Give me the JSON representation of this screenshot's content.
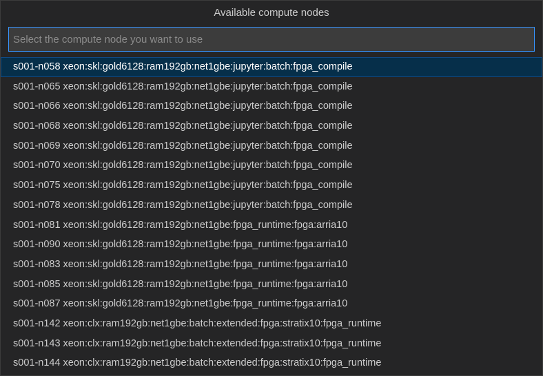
{
  "dialog": {
    "title": "Available compute nodes",
    "input_placeholder": "Select the compute node you want to use",
    "input_value": ""
  },
  "items": [
    {
      "label": "s001-n058 xeon:skl:gold6128:ram192gb:net1gbe:jupyter:batch:fpga_compile",
      "selected": true
    },
    {
      "label": "s001-n065 xeon:skl:gold6128:ram192gb:net1gbe:jupyter:batch:fpga_compile",
      "selected": false
    },
    {
      "label": "s001-n066 xeon:skl:gold6128:ram192gb:net1gbe:jupyter:batch:fpga_compile",
      "selected": false
    },
    {
      "label": "s001-n068 xeon:skl:gold6128:ram192gb:net1gbe:jupyter:batch:fpga_compile",
      "selected": false
    },
    {
      "label": "s001-n069 xeon:skl:gold6128:ram192gb:net1gbe:jupyter:batch:fpga_compile",
      "selected": false
    },
    {
      "label": "s001-n070 xeon:skl:gold6128:ram192gb:net1gbe:jupyter:batch:fpga_compile",
      "selected": false
    },
    {
      "label": "s001-n075 xeon:skl:gold6128:ram192gb:net1gbe:jupyter:batch:fpga_compile",
      "selected": false
    },
    {
      "label": "s001-n078 xeon:skl:gold6128:ram192gb:net1gbe:jupyter:batch:fpga_compile",
      "selected": false
    },
    {
      "label": "s001-n081 xeon:skl:gold6128:ram192gb:net1gbe:fpga_runtime:fpga:arria10",
      "selected": false
    },
    {
      "label": "s001-n090 xeon:skl:gold6128:ram192gb:net1gbe:fpga_runtime:fpga:arria10",
      "selected": false
    },
    {
      "label": "s001-n083 xeon:skl:gold6128:ram192gb:net1gbe:fpga_runtime:fpga:arria10",
      "selected": false
    },
    {
      "label": "s001-n085 xeon:skl:gold6128:ram192gb:net1gbe:fpga_runtime:fpga:arria10",
      "selected": false
    },
    {
      "label": "s001-n087 xeon:skl:gold6128:ram192gb:net1gbe:fpga_runtime:fpga:arria10",
      "selected": false
    },
    {
      "label": "s001-n142 xeon:clx:ram192gb:net1gbe:batch:extended:fpga:stratix10:fpga_runtime",
      "selected": false
    },
    {
      "label": "s001-n143 xeon:clx:ram192gb:net1gbe:batch:extended:fpga:stratix10:fpga_runtime",
      "selected": false
    },
    {
      "label": "s001-n144 xeon:clx:ram192gb:net1gbe:batch:extended:fpga:stratix10:fpga_runtime",
      "selected": false
    }
  ],
  "colors": {
    "background": "#252526",
    "input_border": "#3794ff",
    "selected_background": "#062f4a"
  }
}
